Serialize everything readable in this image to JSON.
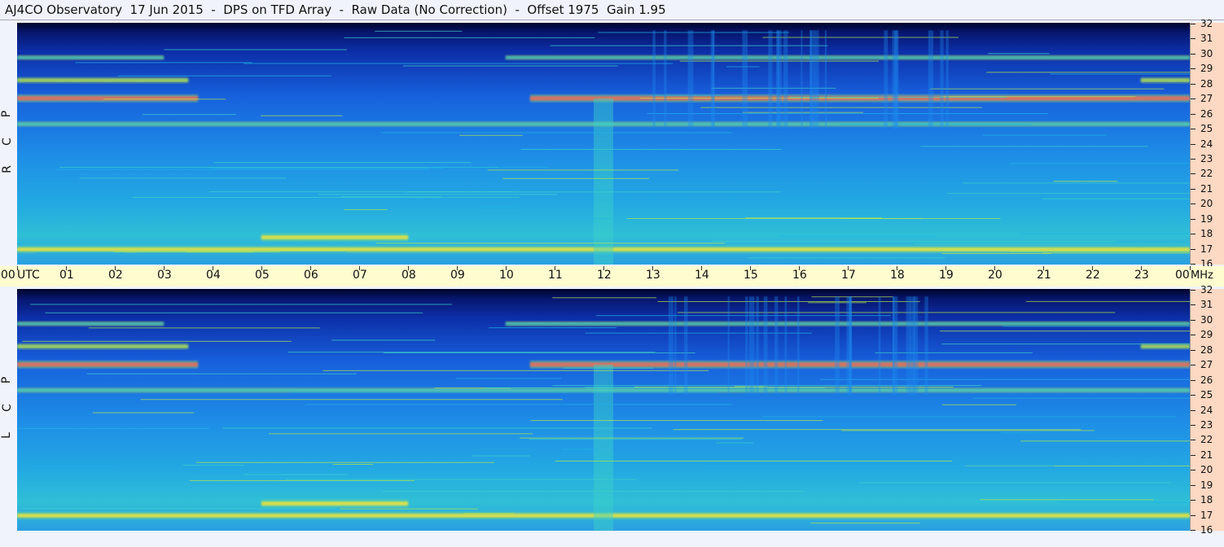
{
  "title": "AJ4CO Observatory  17 Jun 2015  -  DPS on TFD Array  -  Raw Data (No Correction)  -  Offset 1975  Gain 1.95",
  "panels": [
    {
      "name": "rcp",
      "label_letters": [
        "R",
        "C",
        "P"
      ]
    },
    {
      "name": "lcp",
      "label_letters": [
        "L",
        "C",
        "P"
      ]
    }
  ],
  "time_axis": {
    "labels": [
      "00",
      "01",
      "02",
      "03",
      "04",
      "05",
      "06",
      "07",
      "08",
      "09",
      "10",
      "11",
      "12",
      "13",
      "14",
      "15",
      "16",
      "17",
      "18",
      "19",
      "20",
      "21",
      "22",
      "23",
      "00"
    ],
    "unit": "UTC",
    "freq_unit": "MHz"
  },
  "freq_axis": {
    "labels": [
      "32",
      "31",
      "30",
      "29",
      "28",
      "27",
      "26",
      "25",
      "24",
      "23",
      "22",
      "21",
      "20",
      "19",
      "18",
      "17",
      "16"
    ]
  },
  "colors": {
    "background": "#f0f3fb",
    "time_bar": "#fffccf",
    "freq_scale": "#fdd8c2",
    "colormap": [
      "#000020",
      "#0a1e8c",
      "#1e5ae6",
      "#1e8cf0",
      "#1eb4e6",
      "#3cd2c8",
      "#b4e650",
      "#ffe632",
      "#ff6450"
    ]
  },
  "chart_data": {
    "type": "heatmap",
    "title": "AJ4CO Observatory  17 Jun 2015  -  DPS on TFD Array  -  Raw Data (No Correction)  -  Offset 1975  Gain 1.95",
    "x_unit": "UTC hour",
    "y_unit": "MHz",
    "xlim": [
      0,
      24
    ],
    "ylim": [
      16,
      32
    ],
    "panels": [
      "RCP",
      "LCP"
    ],
    "features": [
      {
        "kind": "band",
        "freq": 27.0,
        "strength": 0.9,
        "active_hours": [
          [
            0,
            3.7
          ],
          [
            10.5,
            24
          ]
        ]
      },
      {
        "kind": "band",
        "freq": 28.2,
        "strength": 0.55,
        "active_hours": [
          [
            0,
            3.5
          ],
          [
            23,
            24
          ]
        ]
      },
      {
        "kind": "band",
        "freq": 29.7,
        "strength": 0.35,
        "active_hours": [
          [
            0,
            3
          ],
          [
            10,
            24
          ]
        ]
      },
      {
        "kind": "band",
        "freq": 17.8,
        "strength": 0.75,
        "active_hours": [
          [
            5,
            8
          ]
        ]
      },
      {
        "kind": "band",
        "freq": 17.0,
        "strength": 0.7,
        "active_hours": [
          [
            0,
            24
          ]
        ]
      },
      {
        "kind": "band",
        "freq": 25.3,
        "strength": 0.35,
        "active_hours": [
          [
            0,
            24
          ]
        ]
      },
      {
        "kind": "vertical_stripe",
        "hour": 12,
        "strength": 0.5
      }
    ]
  }
}
